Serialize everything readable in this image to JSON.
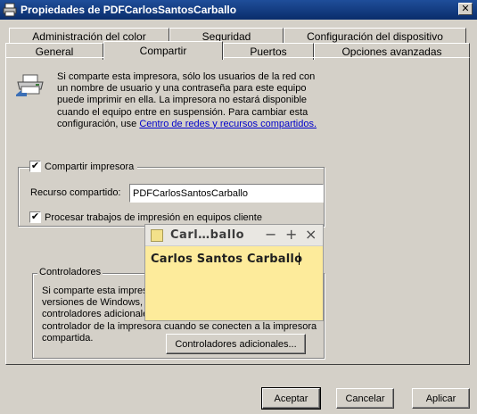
{
  "window": {
    "title": "Propiedades de PDFCarlosSantosCarballo",
    "close_label": "✕"
  },
  "tabs_row1": [
    "Administración del color",
    "Seguridad",
    "Configuración del dispositivo"
  ],
  "tabs_row2": [
    "General",
    "Compartir",
    "Puertos",
    "Opciones avanzadas"
  ],
  "intro": {
    "text": "Si comparte esta impresora, sólo los usuarios de la red con un nombre de usuario y una contraseña para este equipo puede imprimir en ella. La impresora no estará disponible cuando el equipo entre en suspensión. Para cambiar esta configuración, use ",
    "link": "Centro de redes y recursos compartidos."
  },
  "share": {
    "checkbox_label": "Compartir impresora",
    "resource_label": "Recurso compartido:",
    "resource_value": "PDFCarlosSantosCarballo",
    "client_render_label": "Procesar trabajos de impresión en equipos cliente",
    "share_checked": true,
    "client_render_checked": true
  },
  "drivers": {
    "group_label": "Controladores",
    "text": "Si comparte esta impresora con usuarios que ejecuten distintas versiones de Windows, es posible que quiera instalar controladores adicionales para que no tengan que buscar el controlador de la impresora cuando se conecten a la impresora compartida.",
    "button": "Controladores adicionales..."
  },
  "buttons": {
    "ok": "Aceptar",
    "cancel": "Cancelar",
    "apply": "Aplicar"
  },
  "sticky_note": {
    "title": "Carl…ballo",
    "body": "Carlos Santos Carballo",
    "minimize": "−",
    "maximize": "+",
    "close": "×"
  }
}
